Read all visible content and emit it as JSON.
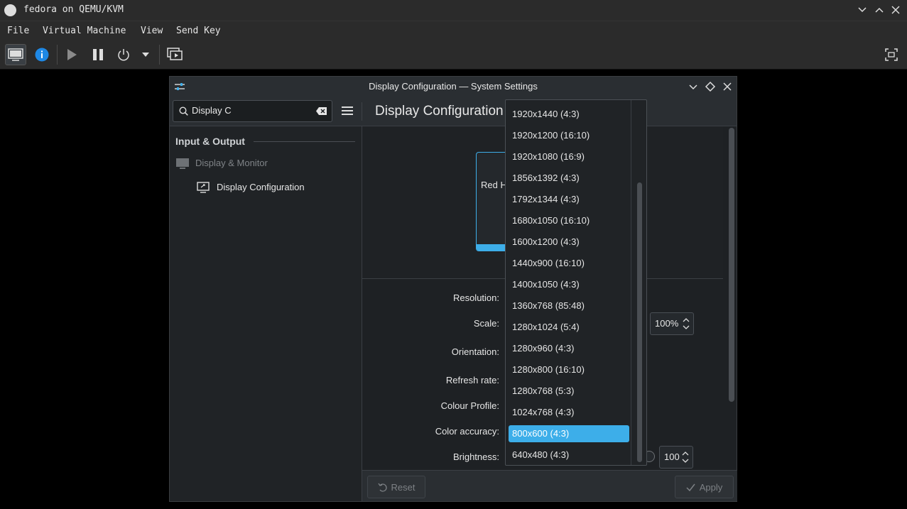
{
  "host": {
    "title": "fedora on QEMU/KVM",
    "menu": [
      "File",
      "Virtual Machine",
      "View",
      "Send Key"
    ]
  },
  "settings": {
    "window_title": "Display Configuration — System Settings",
    "search": {
      "value": "Display C"
    },
    "page_title": "Display Configuration",
    "sidebar": {
      "section": "Input & Output",
      "items": [
        {
          "label": "Display & Monitor"
        },
        {
          "label": "Display Configuration"
        }
      ]
    },
    "preview": {
      "monitor_label": "Red H"
    },
    "form": {
      "resolution": "Resolution:",
      "scale": "Scale:",
      "scale_value": "100%",
      "orientation": "Orientation:",
      "refresh": "Refresh rate:",
      "colour_profile": "Colour Profile:",
      "color_accuracy": "Color accuracy:",
      "brightness": "Brightness:",
      "brightness_value": "100"
    },
    "footer": {
      "reset": "Reset",
      "apply": "Apply"
    }
  },
  "resolution_options": [
    "1920x1440 (4:3)",
    "1920x1200 (16:10)",
    "1920x1080 (16:9)",
    "1856x1392 (4:3)",
    "1792x1344 (4:3)",
    "1680x1050 (16:10)",
    "1600x1200 (4:3)",
    "1440x900 (16:10)",
    "1400x1050 (4:3)",
    "1360x768 (85:48)",
    "1280x1024 (5:4)",
    "1280x960 (4:3)",
    "1280x800 (16:10)",
    "1280x768 (5:3)",
    "1024x768 (4:3)",
    "800x600 (4:3)",
    "640x480 (4:3)"
  ],
  "selected_resolution": "800x600 (4:3)",
  "colors": {
    "accent": "#3daee9",
    "window_bg": "#202326",
    "titlebar": "#2a2e32"
  }
}
